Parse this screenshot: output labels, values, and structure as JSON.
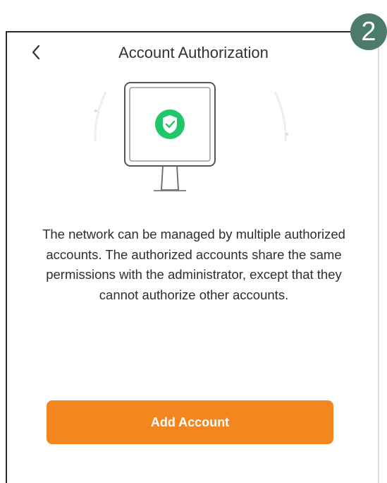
{
  "header": {
    "title": "Account Authorization",
    "back_icon": "chevron-left-icon"
  },
  "step_badge": {
    "label": "2",
    "color": "#4b7b6b"
  },
  "illustration": {
    "icon": "monitor-shield-icon",
    "shield_color": "#1fc66a"
  },
  "description": "The network can be managed by multiple authorized accounts. The authorized accounts share the same permissions with the administrator, except that they cannot authorize other accounts.",
  "actions": {
    "add_account_label": "Add Account",
    "accent_color": "#f5861f"
  }
}
